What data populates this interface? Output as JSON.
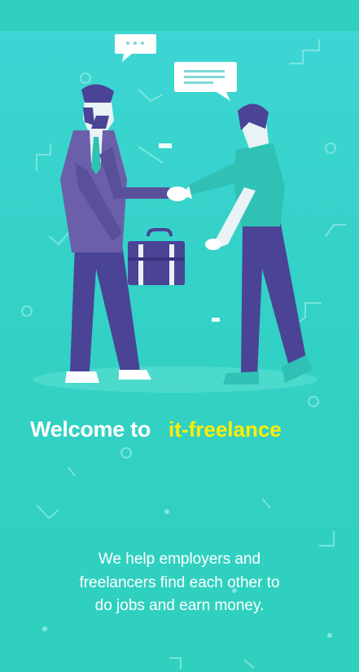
{
  "welcome": {
    "prefix": "Welcome to",
    "brand": "it-freelance"
  },
  "description": {
    "lines": [
      "We help employers and",
      "freelancers find each other to",
      "do jobs and earn money."
    ]
  },
  "colors": {
    "background": "#33d1c6",
    "brand": "#ffee00",
    "suit": "#6a5fa8",
    "shirt": "#2fc2b4"
  },
  "icons": [
    "speech-bubble-icon",
    "chat-bubble-icon",
    "briefcase-icon"
  ]
}
